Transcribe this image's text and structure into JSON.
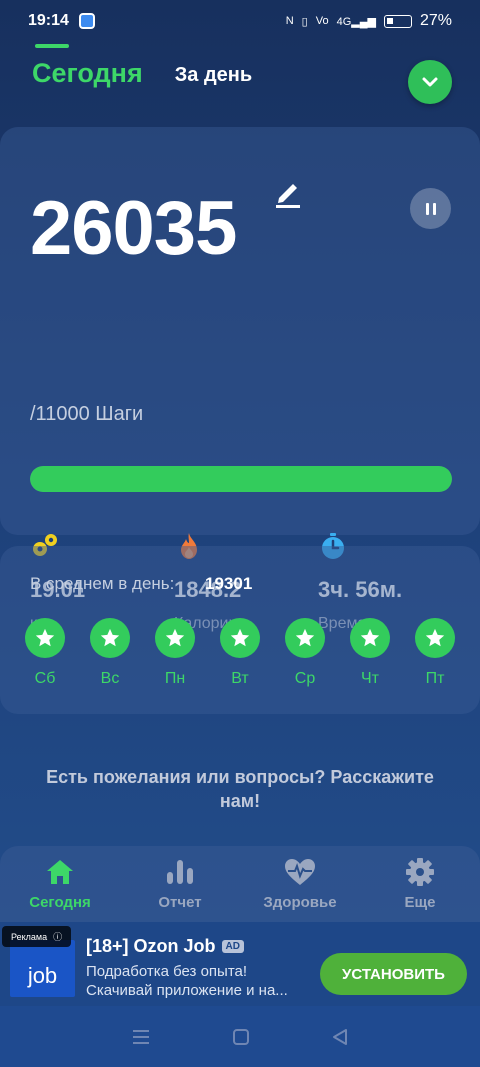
{
  "status_bar": {
    "time": "19:14",
    "battery_pct": "27%",
    "icons": [
      "nfc-icon",
      "vibrate-icon",
      "volte-icon",
      "signal-4g-icon",
      "battery-icon"
    ]
  },
  "tabs": {
    "today": "Сегодня",
    "per_day": "За день"
  },
  "steps": {
    "value": "26035",
    "goal_text": "/11000 Шаги",
    "progress": 1.0,
    "accent": "#33cc5c"
  },
  "stats": [
    {
      "icon": "distance-icon",
      "value": "19.01",
      "label": "км",
      "color": "#f0d020"
    },
    {
      "icon": "flame-icon",
      "value": "1848.2",
      "label": "Калории",
      "color": "#f07a3a"
    },
    {
      "icon": "stopwatch-icon",
      "value": "3ч. 56м.",
      "label": "Время",
      "color": "#3aaef0"
    }
  ],
  "average": {
    "label": "В среднем в день:",
    "value": "19301",
    "days": [
      "Сб",
      "Вс",
      "Пн",
      "Вт",
      "Ср",
      "Чт",
      "Пт"
    ]
  },
  "feedback": {
    "text": "Есть пожелания или вопросы? Расскажите нам!"
  },
  "bottom_nav": [
    {
      "icon": "home-icon",
      "label": "Сегодня"
    },
    {
      "icon": "bar-chart-icon",
      "label": "Отчет"
    },
    {
      "icon": "heart-pulse-icon",
      "label": "Здоровье"
    },
    {
      "icon": "gear-icon",
      "label": "Еще"
    }
  ],
  "ad": {
    "badge": "Реклама",
    "logo_text": "job",
    "title": "[18+] Ozon Job",
    "tag": "AD",
    "desc_line1": "Подработка без опыта!",
    "desc_line2": "Скачивай приложение и на...",
    "button": "УСТАНОВИТЬ"
  }
}
